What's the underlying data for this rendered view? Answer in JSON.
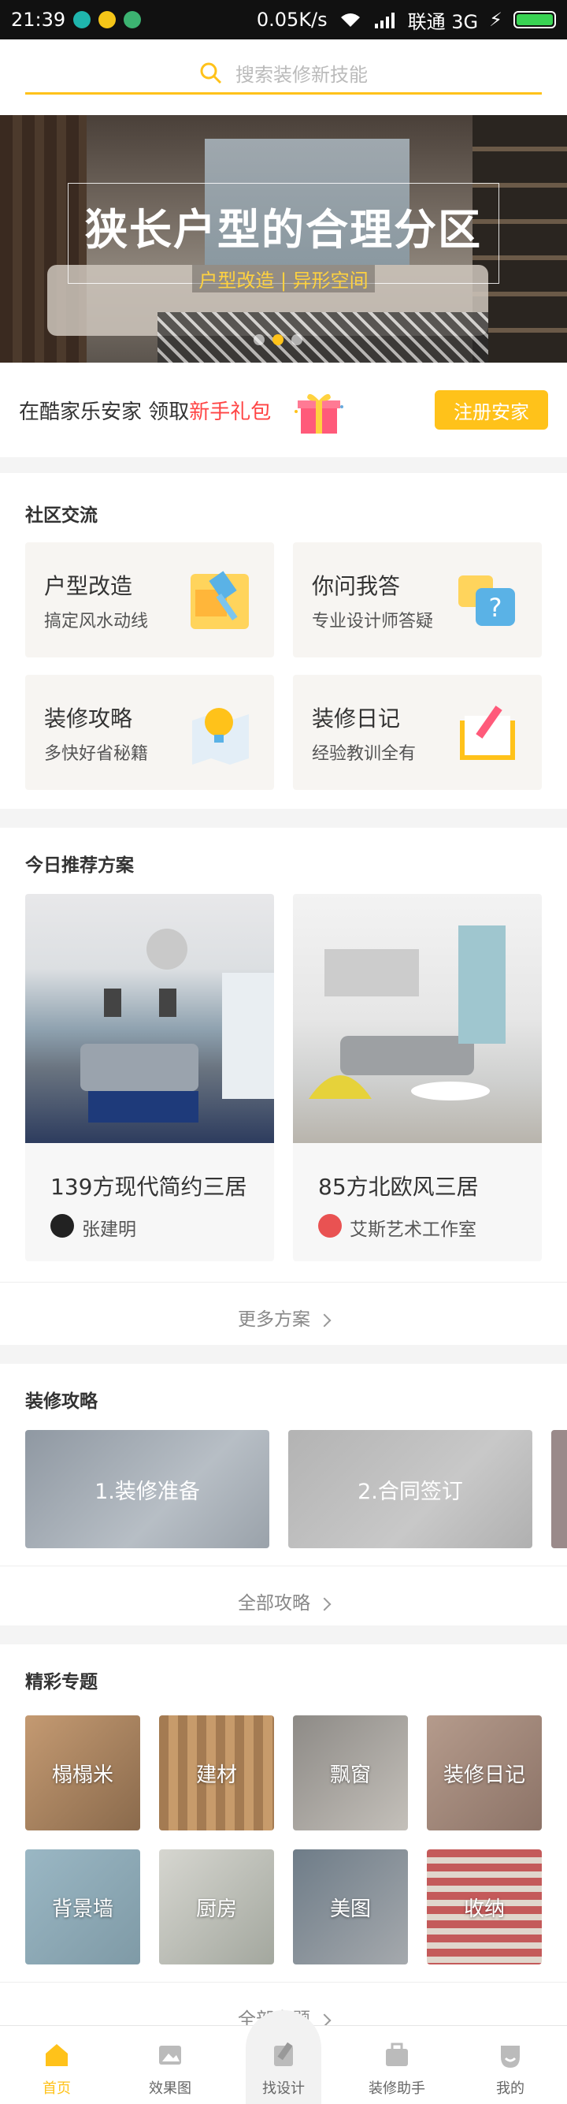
{
  "status": {
    "time": "21:39",
    "network_speed": "0.05K/s",
    "carrier": "联通 3G"
  },
  "search": {
    "placeholder": "搜索装修新技能"
  },
  "banner": {
    "title": "狭长户型的合理分区",
    "subtitle": "户型改造 | 异形空间"
  },
  "promo": {
    "text_prefix": "在酷家乐安家 领取",
    "text_highlight": "新手礼包",
    "button_label": "注册安家"
  },
  "community": {
    "title": "社区交流",
    "cards": [
      {
        "title": "户型改造",
        "subtitle": "搞定风水动线",
        "icon": "hammer-icon"
      },
      {
        "title": "你问我答",
        "subtitle": "专业设计师答疑",
        "icon": "question-bubble-icon"
      },
      {
        "title": "装修攻略",
        "subtitle": "多快好省秘籍",
        "icon": "lightbulb-map-icon"
      },
      {
        "title": "装修日记",
        "subtitle": "经验教训全有",
        "icon": "diary-pen-icon"
      }
    ]
  },
  "recommend": {
    "title": "今日推荐方案",
    "items": [
      {
        "title": "139方现代简约三居",
        "author": "张建明"
      },
      {
        "title": "85方北欧风三居",
        "author": "艾斯艺术工作室"
      }
    ],
    "more_label": "更多方案"
  },
  "guides": {
    "title": "装修攻略",
    "items": [
      {
        "label": "1.装修准备"
      },
      {
        "label": "2.合同签订"
      }
    ],
    "more_label": "全部攻略"
  },
  "topics": {
    "title": "精彩专题",
    "items": [
      {
        "label": "榻榻米"
      },
      {
        "label": "建材"
      },
      {
        "label": "飘窗"
      },
      {
        "label": "装修日记"
      },
      {
        "label": "背景墙"
      },
      {
        "label": "厨房"
      },
      {
        "label": "美图"
      },
      {
        "label": "收纳"
      }
    ],
    "more_label": "全部专题"
  },
  "nav": {
    "items": [
      {
        "label": "首页"
      },
      {
        "label": "效果图"
      },
      {
        "label": "找设计"
      },
      {
        "label": "装修助手"
      },
      {
        "label": "我的"
      }
    ]
  },
  "colors": {
    "accent": "#ffc21a",
    "highlight": "#ff4444"
  }
}
